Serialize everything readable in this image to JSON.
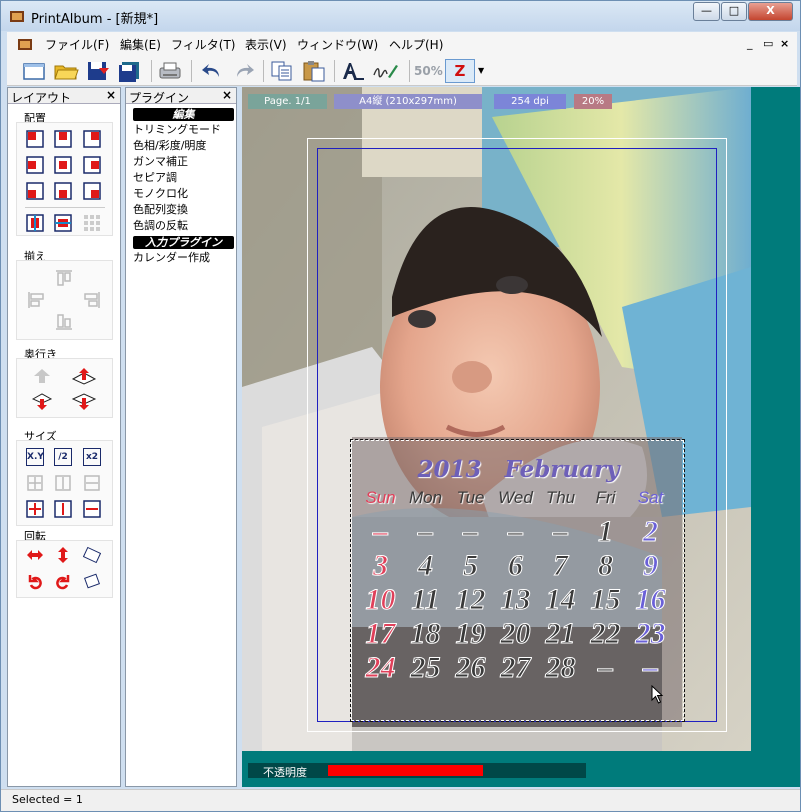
{
  "window": {
    "title": "PrintAlbum - [新規*]",
    "buttons": {
      "minimize": "—",
      "maximize": "□",
      "close": "X"
    }
  },
  "menubar": {
    "items": [
      "ファイル(F)",
      "編集(E)",
      "フィルタ(T)",
      "表示(V)",
      "ウィンドウ(W)",
      "ヘルプ(H)"
    ],
    "mdi_controls": {
      "minimize": "_",
      "restore": "▭",
      "close": "×"
    }
  },
  "toolbar": {
    "zoom_label": "50%",
    "z_label": "Z"
  },
  "layout_panel": {
    "title": "レイアウト",
    "close": "×",
    "groups": {
      "placement": "配置",
      "align": "揃え",
      "depth": "奥行き",
      "size": "サイズ",
      "rotation": "回転"
    },
    "size_labels": {
      "xy": "X.Y",
      "half": "/2",
      "double": "x2"
    }
  },
  "plugin_panel": {
    "title": "プラグイン",
    "close": "×",
    "edit_section": "編集",
    "edit_items": [
      "トリミングモード",
      "色相/彩度/明度",
      "ガンマ補正",
      "セピア調",
      "モノクロ化",
      "色配列変換",
      "色調の反転"
    ],
    "input_section": "入力プラグイン",
    "input_items": [
      "カレンダー作成"
    ]
  },
  "canvas_info": {
    "page": "Page. 1/1",
    "paper": "A4縦 (210x297mm)",
    "dpi": "254 dpi",
    "zoom": "20%"
  },
  "calendar": {
    "title": "2013　February",
    "weekdays": [
      "Sun",
      "Mon",
      "Tue",
      "Wed",
      "Thu",
      "Fri",
      "Sat"
    ],
    "weeks": [
      [
        "–",
        "–",
        "–",
        "–",
        "–",
        "1",
        "2"
      ],
      [
        "3",
        "4",
        "5",
        "6",
        "7",
        "8",
        "9"
      ],
      [
        "10",
        "11",
        "12",
        "13",
        "14",
        "15",
        "16"
      ],
      [
        "17",
        "18",
        "19",
        "20",
        "21",
        "22",
        "23"
      ],
      [
        "24",
        "25",
        "26",
        "27",
        "28",
        "–",
        "–"
      ]
    ]
  },
  "opacity": {
    "label": "不透明度",
    "value": 0.6
  },
  "status": {
    "text": "Selected = 1"
  },
  "colors": {
    "teal_background": "#007b7b",
    "sunday": "#e0405a",
    "saturday": "#6a60d8",
    "weekday": "#3a3a3a",
    "opacity_bar": "#ff0000"
  }
}
